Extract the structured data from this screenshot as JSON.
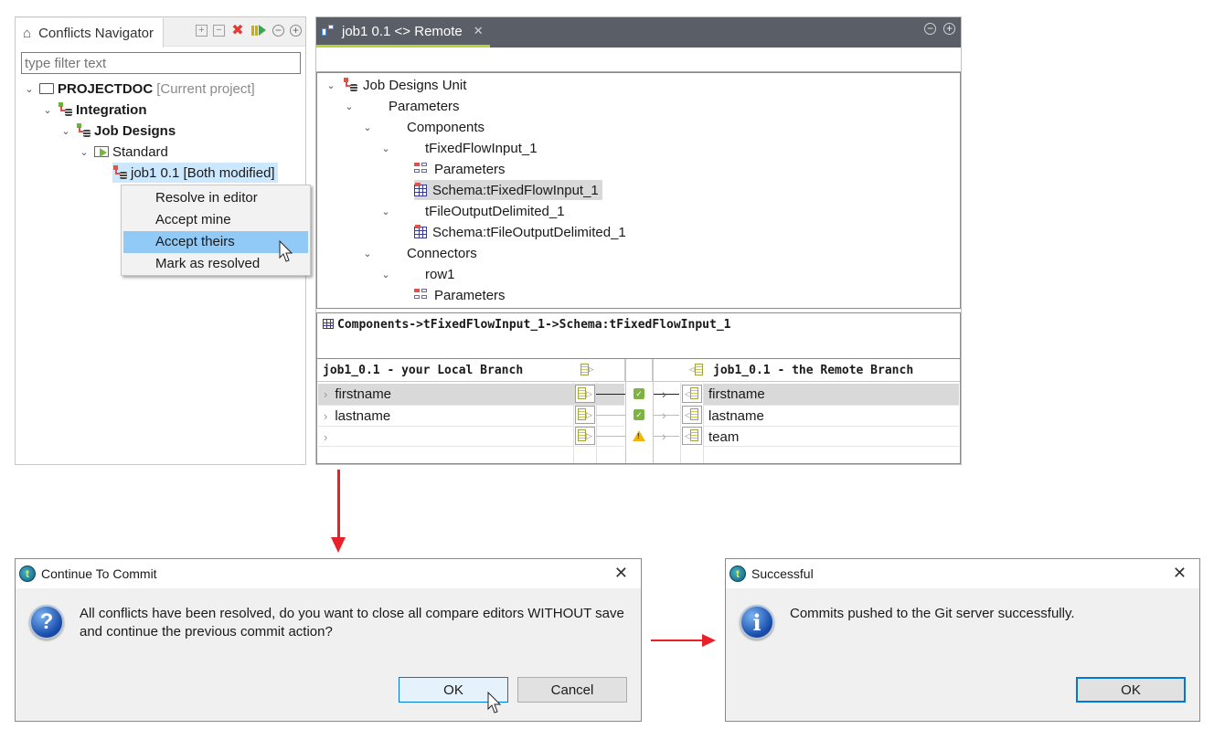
{
  "navigator": {
    "tab_title": "Conflicts Navigator",
    "toolbar_icons": [
      "expand-all-icon",
      "collapse-all-icon",
      "delete-icon",
      "resume-icon",
      "minimize-icon",
      "maximize-icon"
    ],
    "filter_placeholder": "type filter text",
    "tree": {
      "project_name": "PROJECTDOC",
      "project_suffix": "[Current project]",
      "integration": "Integration",
      "job_designs": "Job Designs",
      "standard": "Standard",
      "job": "job1 0.1 [Both modified]"
    },
    "context_menu": {
      "items": [
        "Resolve in editor",
        "Accept mine",
        "Accept theirs",
        "Mark as resolved"
      ],
      "highlighted_index": 2
    }
  },
  "editor": {
    "tab_title": "job1 0.1 <> Remote",
    "tree": {
      "root": "Job Designs Unit",
      "parameters": "Parameters",
      "components": "Components",
      "comp1": "tFixedFlowInput_1",
      "comp1_params": "Parameters",
      "comp1_schema": "Schema:tFixedFlowInput_1",
      "comp2": "tFileOutputDelimited_1",
      "comp2_schema": "Schema:tFileOutputDelimited_1",
      "connectors": "Connectors",
      "row1": "row1",
      "row1_params": "Parameters"
    },
    "path": "Components->tFixedFlowInput_1->Schema:tFixedFlowInput_1",
    "compare": {
      "local_header": "job1_0.1 - your Local Branch",
      "remote_header": "job1_0.1 - the Remote Branch",
      "local_rows": [
        "firstname",
        "lastname",
        ""
      ],
      "remote_rows": [
        "firstname",
        "lastname",
        "team"
      ],
      "status": [
        "ok",
        "ok",
        "warning"
      ]
    }
  },
  "dialog_commit": {
    "title": "Continue To Commit",
    "message_line1": "All conflicts have been resolved, do you want to close all compare editors WITHOUT save",
    "message_line2": "and continue the previous commit action?",
    "ok_label": "OK",
    "cancel_label": "Cancel",
    "icon": "question-icon"
  },
  "dialog_success": {
    "title": "Successful",
    "message": "Commits pushed to the Git server successfully.",
    "ok_label": "OK",
    "icon": "info-icon"
  },
  "colors": {
    "tab_accent": "#b7d433",
    "editor_header": "#5a5e66",
    "selection": "#cce8ff",
    "menu_highlight": "#91c9f7",
    "arrow_red": "#e8202a",
    "button_focus": "#0078d7"
  }
}
